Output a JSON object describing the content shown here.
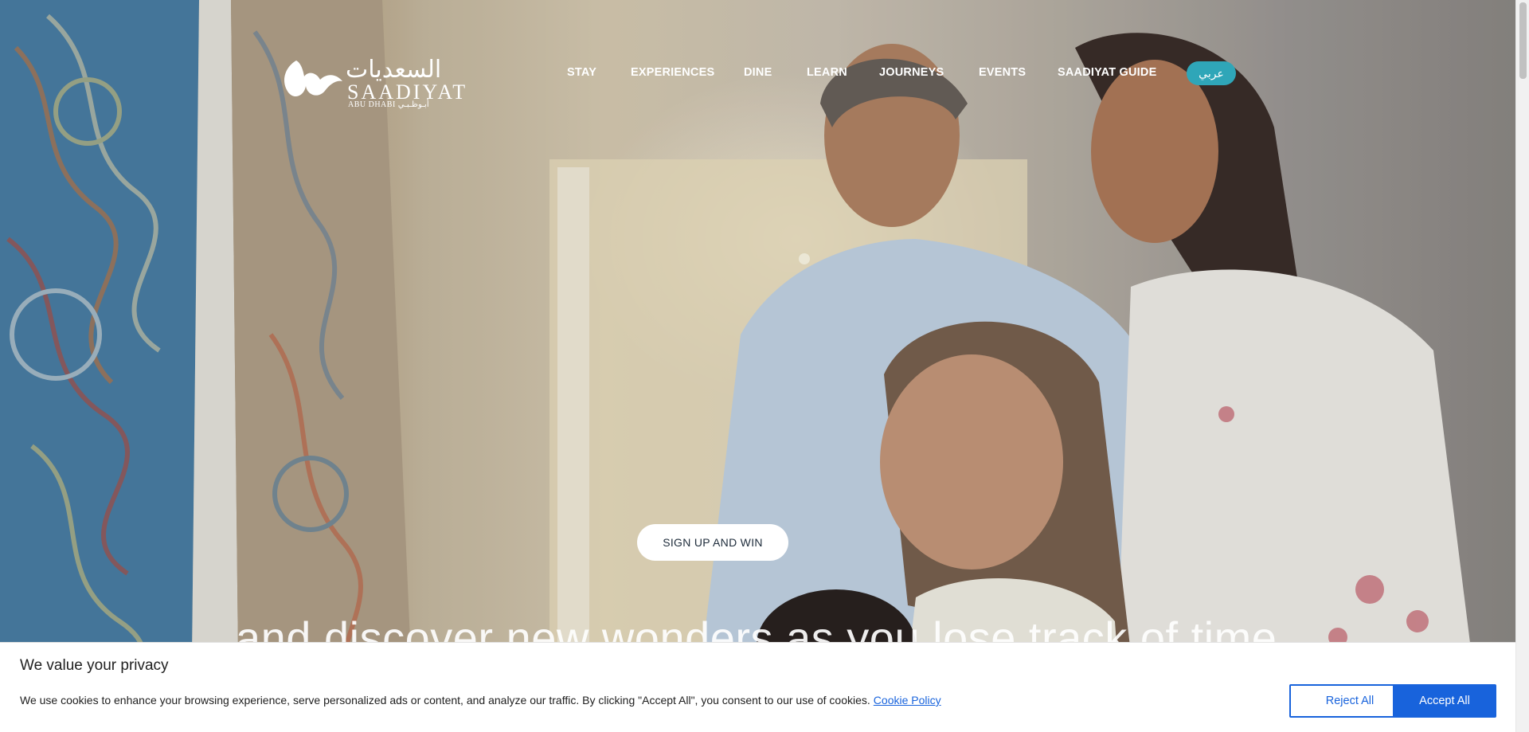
{
  "brand": {
    "arabic": "السعديات",
    "latin": "SAADIYAT",
    "sub": "ABU DHABI  أبـوظـبـي"
  },
  "nav": {
    "items": [
      {
        "label": "STAY"
      },
      {
        "label": "EXPERIENCES"
      },
      {
        "label": "DINE"
      },
      {
        "label": "LEARN"
      },
      {
        "label": "JOURNEYS"
      },
      {
        "label": "EVENTS"
      },
      {
        "label": "SAADIYAT GUIDE"
      }
    ],
    "language_toggle": "عربي"
  },
  "hero": {
    "cta_label": "SIGN UP AND WIN",
    "tagline": "and discover new wonders as you lose track of time"
  },
  "cookie_banner": {
    "title": "We value your privacy",
    "text": "We use cookies to enhance your browsing experience, serve personalized ads or content, and analyze our traffic. By clicking \"Accept All\", you consent to our use of cookies.",
    "policy_link": "Cookie Policy",
    "reject_label": "Reject All",
    "accept_label": "Accept All"
  },
  "colors": {
    "accent_teal": "#2fa6b8",
    "cookie_blue": "#1863dc"
  }
}
